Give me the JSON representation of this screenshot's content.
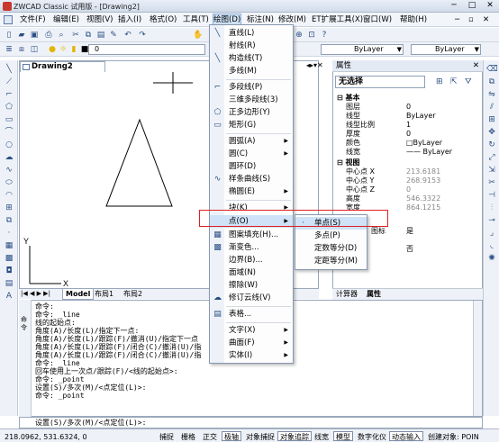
{
  "title": "ZWCAD Classic 试用版 - [Drawing2]",
  "menubar": [
    "文件(F)",
    "编辑(E)",
    "视图(V)",
    "插入(I)",
    "格式(O)",
    "工具(T)",
    "绘图(D)",
    "标注(N)",
    "修改(M)",
    "ET扩展工具(X)",
    "窗口(W)",
    "帮助(H)"
  ],
  "toolbar": {
    "layer_value": "0",
    "linetype1": "ByLayer",
    "linetype2": "ByLayer"
  },
  "document_tab": "Drawing2",
  "layout_tabs": [
    "Model",
    "布局1",
    "布局2"
  ],
  "draw_menu": [
    {
      "label": "直线(L)",
      "icon": "line-icon"
    },
    {
      "label": "射线(R)",
      "icon": ""
    },
    {
      "label": "构造线(T)",
      "icon": "xline-icon"
    },
    {
      "label": "多线(M)",
      "icon": ""
    },
    {
      "label": "多段线(P)",
      "icon": "polyline-icon"
    },
    {
      "label": "三维多段线(3)",
      "icon": ""
    },
    {
      "label": "正多边形(Y)",
      "icon": "polygon-icon"
    },
    {
      "label": "矩形(G)",
      "icon": "rectangle-icon"
    },
    {
      "label": "圆弧(A)",
      "icon": ""
    },
    {
      "label": "圆(C)",
      "icon": ""
    },
    {
      "label": "圆环(D)",
      "icon": ""
    },
    {
      "label": "样条曲线(S)",
      "icon": "spline-icon"
    },
    {
      "label": "椭圆(E)",
      "icon": ""
    },
    {
      "label": "块(K)",
      "icon": ""
    },
    {
      "label": "点(O)",
      "icon": ""
    },
    {
      "label": "图案填充(H)...",
      "icon": "hatch-icon"
    },
    {
      "label": "渐变色...",
      "icon": "gradient-icon"
    },
    {
      "label": "边界(B)...",
      "icon": ""
    },
    {
      "label": "面域(N)",
      "icon": ""
    },
    {
      "label": "擦除(W)",
      "icon": ""
    },
    {
      "label": "修订云线(V)",
      "icon": "revcloud-icon"
    },
    {
      "label": "表格...",
      "icon": "table-icon"
    },
    {
      "label": "文字(X)",
      "icon": ""
    },
    {
      "label": "曲面(F)",
      "icon": ""
    },
    {
      "label": "实体(I)",
      "icon": ""
    }
  ],
  "point_submenu": [
    "单点(S)",
    "多点(P)",
    "定数等分(D)",
    "定距等分(M)"
  ],
  "properties": {
    "header": "属性",
    "selection": "无选择",
    "cat_basic": "基本",
    "basic": [
      [
        "图层",
        "0"
      ],
      [
        "线型",
        "ByLayer"
      ],
      [
        "线型比例",
        "1"
      ],
      [
        "厚度",
        "0"
      ],
      [
        "颜色",
        "□ByLayer"
      ],
      [
        "线宽",
        "—— ByLayer"
      ]
    ],
    "cat_view": "视图",
    "view": [
      [
        "中心点 X",
        "213.6181"
      ],
      [
        "中心点 Y",
        "268.9153"
      ],
      [
        "中心点 Z",
        "0"
      ],
      [
        "高度",
        "546.3322"
      ],
      [
        "宽度",
        "864.1215"
      ]
    ],
    "extra": [
      [
        "图标",
        "是"
      ],
      [
        "",
        "否"
      ]
    ],
    "footer_tabs": [
      "计算器",
      "属性"
    ]
  },
  "command_lines": [
    "命令:",
    "命令: _line",
    "线的起始点:",
    "角度(A)/长度(L)/指定下一点:",
    "角度(A)/长度(L)/跟踪(F)/撤消(U)/指定下一点",
    "角度(A)/长度(L)/跟踪(F)/闭合(C)/撤消(U)/指",
    "角度(A)/长度(L)/跟踪(F)/闭合(C)/撤消(U)/指",
    "命令: _line",
    "回车使用上一次点/跟踪(F)/<线的起始点>:",
    "命令: _point",
    "设置(S)/多次(M)/<点定位(L)>:",
    "命令: _point"
  ],
  "cmd_prompt": "设置(S)/多次(M)/<点定位(L)>:",
  "cmd_side": "命令",
  "status": {
    "coords": "218.0962, 531.6324, 0",
    "buttons": [
      "捕捉",
      "栅格",
      "正交",
      "极轴",
      "对象捕捉",
      "对象追踪",
      "线宽",
      "模型",
      "数字化仪",
      "动态输入",
      "创建对象: POIN"
    ]
  }
}
